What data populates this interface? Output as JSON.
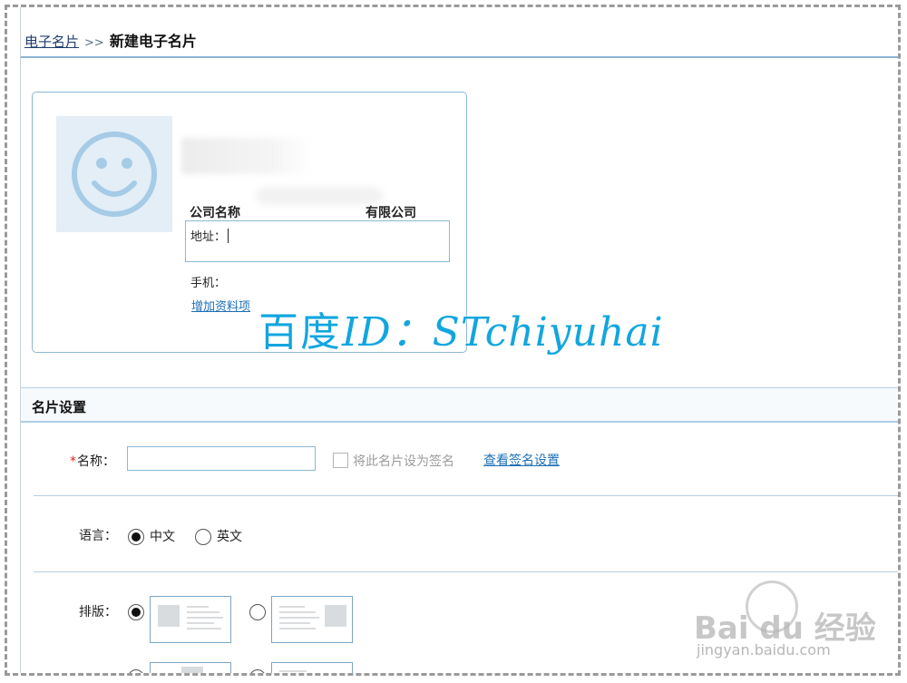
{
  "breadcrumb": {
    "parent": "电子名片",
    "separator": ">>",
    "current": "新建电子名片"
  },
  "card_preview": {
    "company_label": "公司名称",
    "company_suffix": "有限公司",
    "address_label": "地址：",
    "phone_label": "手机：",
    "add_field_link": "增加资料项"
  },
  "watermark": {
    "prefix": "百度",
    "id_text": "ID：",
    "user": "STchiyuhai"
  },
  "settings": {
    "title": "名片设置",
    "name": {
      "required_mark": "*",
      "label": "名称：",
      "value": "",
      "set_signature_label": "将此名片设为签名",
      "set_signature_checked": false,
      "view_signature_link": "查看签名设置"
    },
    "language": {
      "label": "语言：",
      "options": [
        "中文",
        "英文"
      ],
      "selected": "中文"
    },
    "layout": {
      "label": "排版："
    }
  },
  "branding": {
    "logo": "Bai du 经验",
    "url": "jingyan.baidu.com"
  },
  "colors": {
    "accent": "#1d6fb8",
    "border": "#8bb8d4",
    "required": "#e0281f",
    "watermark": "#12a6df"
  }
}
